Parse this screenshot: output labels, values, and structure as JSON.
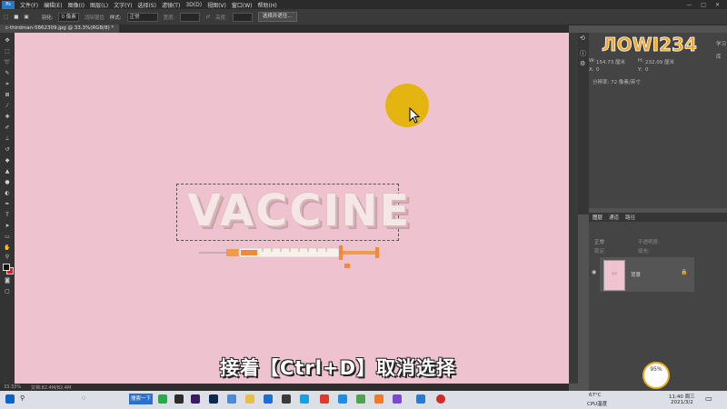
{
  "menubar": {
    "app_icon": "Ps",
    "items": [
      "文件(F)",
      "编辑(E)",
      "图像(I)",
      "图层(L)",
      "文字(Y)",
      "选择(S)",
      "滤镜(T)",
      "3D(D)",
      "视图(V)",
      "窗口(W)",
      "帮助(H)"
    ],
    "window_controls": [
      "—",
      "□",
      "✕"
    ]
  },
  "options": {
    "feather_label": "羽化:",
    "feather_value": "0 像素",
    "antialias_label": "消除锯齿",
    "style_label": "样式:",
    "style_value": "正常",
    "width_label": "宽度:",
    "height_label": "高度:",
    "select_mask_button": "选择并遮住..."
  },
  "document": {
    "tab_title": "c-thirdman-5862309.jpg @ 33.3%(RGB/8) *",
    "zoom": "33.33%",
    "doc_info": "文档:82.4M/82.4M"
  },
  "canvas": {
    "headline": "VACCINE",
    "background_color": "#eec2cf",
    "caption": "接着【Ctrl+D】取消选择"
  },
  "properties": {
    "w_label": "W:",
    "w_value": "154.73 厘米",
    "h_label": "H:",
    "h_value": "232.09 厘米",
    "x_label": "X:",
    "x_value": "0",
    "y_label": "Y:",
    "y_value": "0",
    "resolution": "分辨率: 72 像素/英寸",
    "side_icons": [
      "学习",
      "库"
    ]
  },
  "layers": {
    "tabs": [
      "图层",
      "通道",
      "路径"
    ],
    "mode": "正常",
    "opacity_label": "不透明度:",
    "lock_label": "锁定:",
    "fill_label": "填充:",
    "layer_name": "背景",
    "thumb_caption": "背景"
  },
  "brand": {
    "logo_text": "ЛOWI234"
  },
  "taskbar": {
    "search": "搜索一下",
    "weather_temp": "67°C",
    "weather_label": "CPU温度",
    "time": "11:40 周三",
    "date": "2021/3/2",
    "percent": "95%"
  }
}
